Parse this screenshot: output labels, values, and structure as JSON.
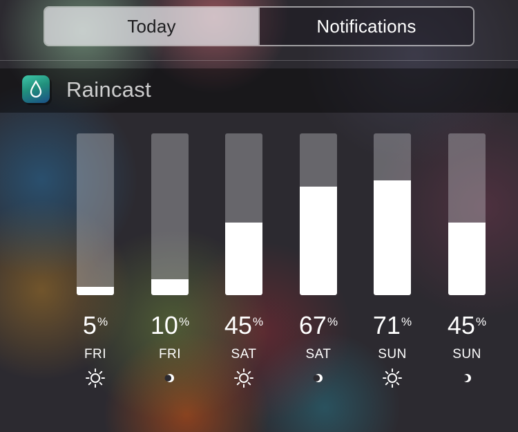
{
  "segmented_control": {
    "today_label": "Today",
    "notifications_label": "Notifications",
    "selected": "Today"
  },
  "widget": {
    "title": "Raincast",
    "icon": "raindrop-icon"
  },
  "forecast": [
    {
      "percent": "5",
      "percent_symbol": "%",
      "day": "FRI",
      "icon": "sun-icon",
      "fill": 0.05
    },
    {
      "percent": "10",
      "percent_symbol": "%",
      "day": "FRI",
      "icon": "moon-icon",
      "fill": 0.1
    },
    {
      "percent": "45",
      "percent_symbol": "%",
      "day": "SAT",
      "icon": "sun-icon",
      "fill": 0.45
    },
    {
      "percent": "67",
      "percent_symbol": "%",
      "day": "SAT",
      "icon": "moon-icon",
      "fill": 0.67
    },
    {
      "percent": "71",
      "percent_symbol": "%",
      "day": "SUN",
      "icon": "sun-icon",
      "fill": 0.71
    },
    {
      "percent": "45",
      "percent_symbol": "%",
      "day": "SUN",
      "icon": "moon-icon",
      "fill": 0.45
    }
  ],
  "colors": {
    "bar_fill": "#ffffff",
    "bar_track": "#8c8c91",
    "icon_gradient_top": "#3fc7a8",
    "icon_gradient_bottom": "#1a4f86"
  }
}
